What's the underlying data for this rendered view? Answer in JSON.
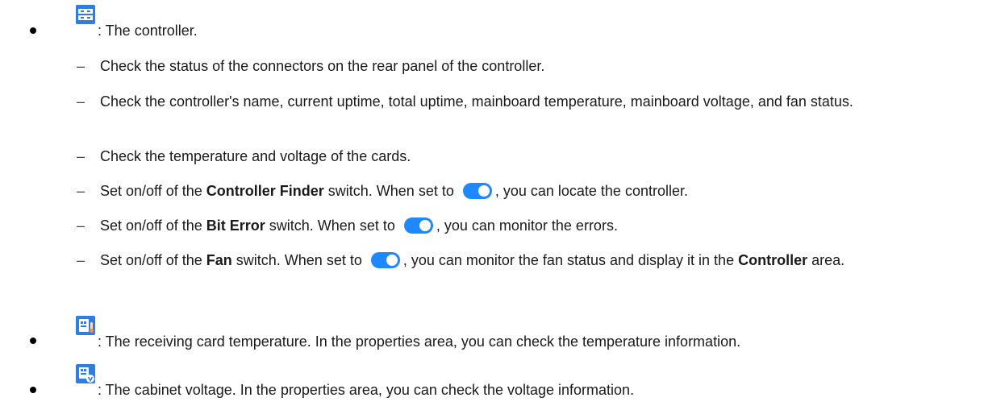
{
  "controller": {
    "desc": ": The controller.",
    "items": [
      "Check the status of the connectors on the rear panel of the controller.",
      "Check the controller's name, current uptime, total uptime, mainboard temperature, mainboard voltage, and fan status.",
      "Check the temperature and voltage of the cards."
    ],
    "finder": {
      "pre": "Set on/off of the ",
      "bold": "Controller Finder",
      "mid": " switch. When set to ",
      "post": ", you can locate the controller."
    },
    "bit_error": {
      "pre": "Set on/off of the ",
      "bold": "Bit Error",
      "mid": " switch. When set to ",
      "post": ", you can monitor the errors."
    },
    "fan": {
      "pre": "Set on/off of the ",
      "bold": "Fan",
      "mid": " switch. When set to ",
      "post": ", you can monitor the fan status and display it in the ",
      "bold2": "Controller",
      "end": " area."
    }
  },
  "receiving_card": {
    "desc": ": The receiving card temperature. In the properties area, you can check the temperature information."
  },
  "cabinet": {
    "desc": ": The cabinet voltage. In the properties area, you can check the voltage information."
  },
  "dash": "–",
  "colors": {
    "icon_blue": "#2f7de1",
    "toggle_blue": "#1e88ff"
  },
  "icons": [
    "controller-icon",
    "receiving-card-temperature-icon",
    "cabinet-voltage-icon",
    "toggle-switch-on-icon"
  ]
}
